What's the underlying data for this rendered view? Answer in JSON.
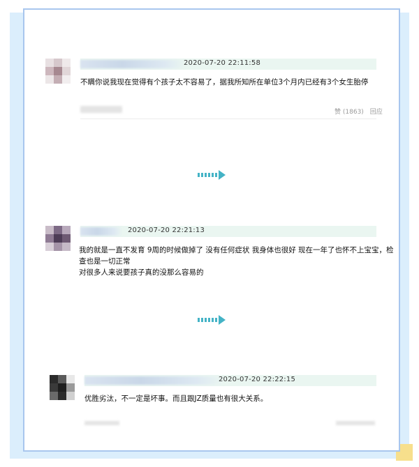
{
  "theme": {
    "accent": "#44b3c6",
    "border": "#a8c6ee",
    "background": "#dbeefc",
    "meta_bar": "#eaf6f1",
    "corner": "#f7df8c"
  },
  "comments": [
    {
      "timestamp": "2020-07-20 22:11:58",
      "lines": [
        "不瞒你说我现在觉得有个孩子太不容易了，据我所知所在单位3个月内已经有3个女生胎停"
      ],
      "likes_label": "赞",
      "likes_count": "(1863)",
      "reply_label": "回应"
    },
    {
      "timestamp": "2020-07-20 22:21:13",
      "lines": [
        "我的就是一直不发育 9周的时候做掉了 没有任何症状 我身体也很好 现在一年了也怀不上宝宝，检",
        "查也是一切正常",
        "对很多人来说要孩子真的没那么容易的"
      ]
    },
    {
      "timestamp": "2020-07-20 22:22:15",
      "lines": [
        "优胜劣汰，不一定是坏事。而且跟JZ质量也有很大关系。"
      ]
    }
  ],
  "more_icon": "double-arrow-right-icon"
}
